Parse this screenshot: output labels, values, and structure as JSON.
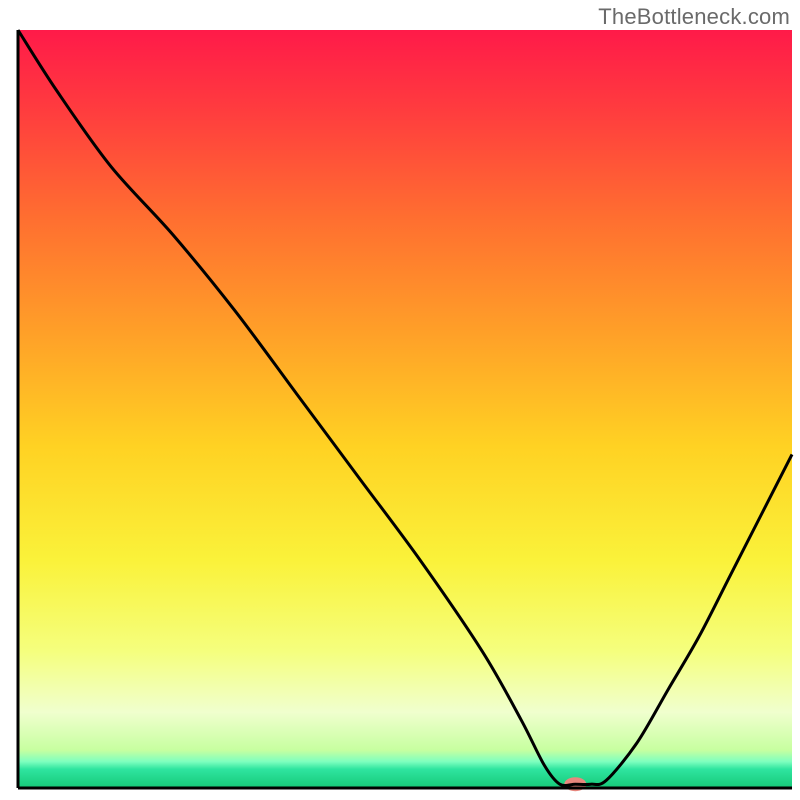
{
  "watermark": "TheBottleneck.com",
  "chart_data": {
    "type": "line",
    "title": "",
    "xlabel": "",
    "ylabel": "",
    "xlim": [
      0,
      100
    ],
    "ylim": [
      0,
      100
    ],
    "grid": false,
    "legend": false,
    "background_gradient": [
      {
        "offset": 0.0,
        "color": "#ff1a49"
      },
      {
        "offset": 0.1,
        "color": "#ff3a3f"
      },
      {
        "offset": 0.25,
        "color": "#ff6f30"
      },
      {
        "offset": 0.4,
        "color": "#ffa028"
      },
      {
        "offset": 0.55,
        "color": "#ffd223"
      },
      {
        "offset": 0.7,
        "color": "#faf23a"
      },
      {
        "offset": 0.82,
        "color": "#f5ff7e"
      },
      {
        "offset": 0.9,
        "color": "#f0ffce"
      },
      {
        "offset": 0.95,
        "color": "#c7ffa0"
      },
      {
        "offset": 0.965,
        "color": "#7fffbf"
      },
      {
        "offset": 0.975,
        "color": "#2fe5a0"
      },
      {
        "offset": 1.0,
        "color": "#16c978"
      }
    ],
    "series": [
      {
        "name": "bottleneck-curve",
        "x": [
          0,
          5,
          12,
          20,
          28,
          36,
          44,
          52,
          60,
          65,
          68,
          70,
          72,
          74,
          76,
          80,
          84,
          88,
          92,
          96,
          100
        ],
        "y": [
          100,
          92,
          82,
          73,
          63,
          52,
          41,
          30,
          18,
          9,
          3,
          0.5,
          0.5,
          0.5,
          1,
          6,
          13,
          20,
          28,
          36,
          44
        ]
      }
    ],
    "marker": {
      "name": "optimal-point",
      "x": 72,
      "y": 0.5,
      "color": "#e7877e",
      "rx": 11,
      "ry": 7
    }
  }
}
